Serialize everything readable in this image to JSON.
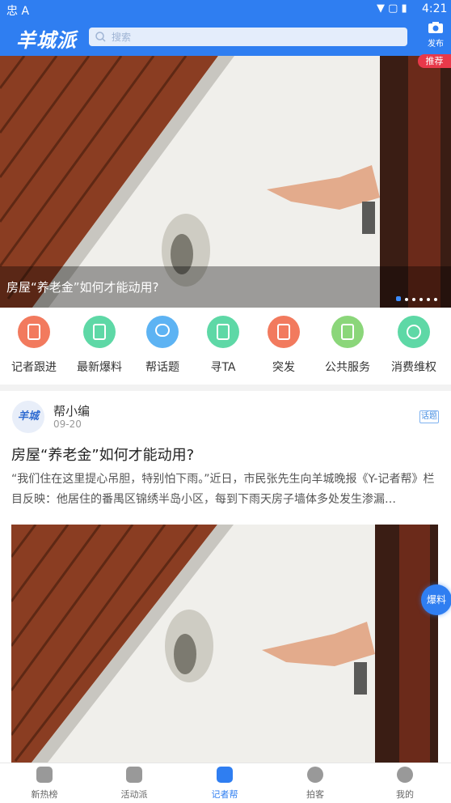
{
  "status": {
    "left_icons": "忠 A",
    "time": "4:21"
  },
  "header": {
    "logo_text": "羊城派",
    "search_placeholder": "搜索",
    "publish_label": "发布"
  },
  "banner": {
    "tag": "推荐",
    "caption": "房屋“养老金”如何才能动用?"
  },
  "categories": [
    {
      "label": "记者跟进",
      "color": "#f27a5e"
    },
    {
      "label": "最新爆料",
      "color": "#5ed8a6"
    },
    {
      "label": "帮话题",
      "color": "#5db3f3"
    },
    {
      "label": "寻TA",
      "color": "#5ed8a6"
    },
    {
      "label": "突发",
      "color": "#f27a5e"
    },
    {
      "label": "公共服务",
      "color": "#8bd67a"
    },
    {
      "label": "消费维权",
      "color": "#5ed8a6"
    }
  ],
  "post": {
    "author": "帮小编",
    "avatar_text": "羊城",
    "date": "09-20",
    "tag": "话题",
    "title": "房屋“养老金”如何才能动用?",
    "summary": "“我们住在这里提心吊胆，特别怕下雨。”近日，市民张先生向羊城晚报《Y-记者帮》栏目反映：他居住的番禺区锦绣半岛小区，每到下雨天房子墙体多处发生渗漏…"
  },
  "fab_label": "爆料",
  "tabs": [
    {
      "label": "新热榜",
      "active": false
    },
    {
      "label": "活动派",
      "active": false
    },
    {
      "label": "记者帮",
      "active": true
    },
    {
      "label": "拍客",
      "active": false
    },
    {
      "label": "我的",
      "active": false
    }
  ]
}
